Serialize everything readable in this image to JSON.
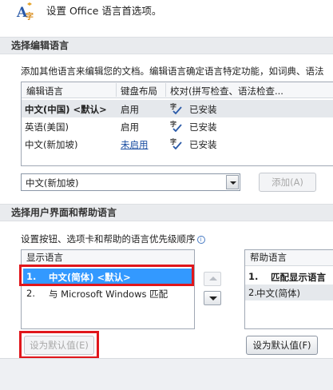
{
  "header": {
    "text": "设置 Office 语言首选项。"
  },
  "editing": {
    "section_title": "选择编辑语言",
    "description": "添加其他语言来编辑您的文档。编辑语言确定语言特定功能，如词典、语法",
    "columns": [
      "编辑语言",
      "键盘布局",
      "校对(拼写检查、语法检查..."
    ],
    "rows": [
      {
        "language": "中文(中国) <默认>",
        "keyboard": "启用",
        "proofing": "已安装",
        "selected": true
      },
      {
        "language": "英语(美国)",
        "keyboard": "启用",
        "proofing": "已安装",
        "selected": false
      },
      {
        "language": "中文(新加坡)",
        "keyboard": "未启用",
        "proofing": "已安装",
        "selected": false
      }
    ],
    "combo_value": "中文(新加坡)",
    "add_button": "添加(A)"
  },
  "ui_help": {
    "section_title": "选择用户界面和帮助语言",
    "description": "设置按钮、选项卡和帮助的语言优先级顺序",
    "display_header": "显示语言",
    "display_items": [
      {
        "num": "1.",
        "label": "中文(简体) <默认>",
        "selected": true
      },
      {
        "num": "2.",
        "label": "与 Microsoft Windows 匹配",
        "selected": false
      }
    ],
    "help_header": "帮助语言",
    "help_items": [
      {
        "num": "1.",
        "label": "匹配显示语言",
        "selected": false
      },
      {
        "num": "2.",
        "label": "中文(简体)",
        "selected": true
      }
    ],
    "set_default_left": "设为默认值(E)",
    "set_default_right": "设为默认值(F)"
  },
  "colors": {
    "highlight": "#3399ff",
    "annotation": "#e0161b",
    "link": "#1a4ea2"
  }
}
